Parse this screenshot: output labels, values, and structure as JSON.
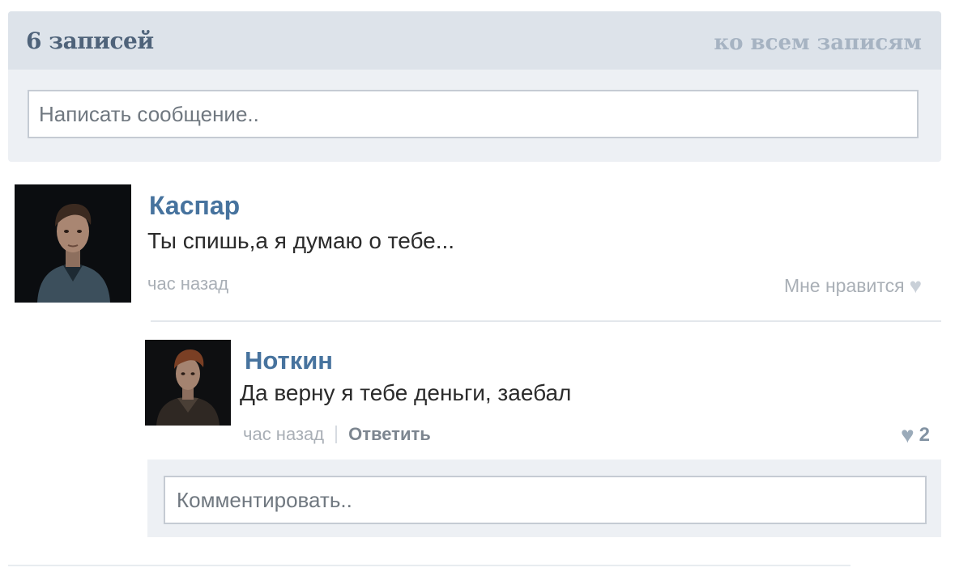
{
  "wall": {
    "posts_count": "6 записей",
    "all_posts_link": "ко всем записям",
    "composer_placeholder": "Написать сообщение.."
  },
  "post": {
    "author": "Каспар",
    "text": "Ты спишь,а я думаю о тебе...",
    "time": "час назад",
    "like_label": "Мне нравится"
  },
  "reply": {
    "author": "Ноткин",
    "text": "Да верну я тебе деньги, заебал",
    "time": "час назад",
    "reply_label": "Ответить",
    "likes_count": "2"
  },
  "comment": {
    "placeholder": "Комментировать.."
  },
  "colors": {
    "author_link": "#47739e",
    "header_bg": "#dde3ea",
    "panel_bg": "#edf0f4",
    "muted_text": "#a9afb6"
  },
  "icons": {
    "like": "heart-icon"
  }
}
